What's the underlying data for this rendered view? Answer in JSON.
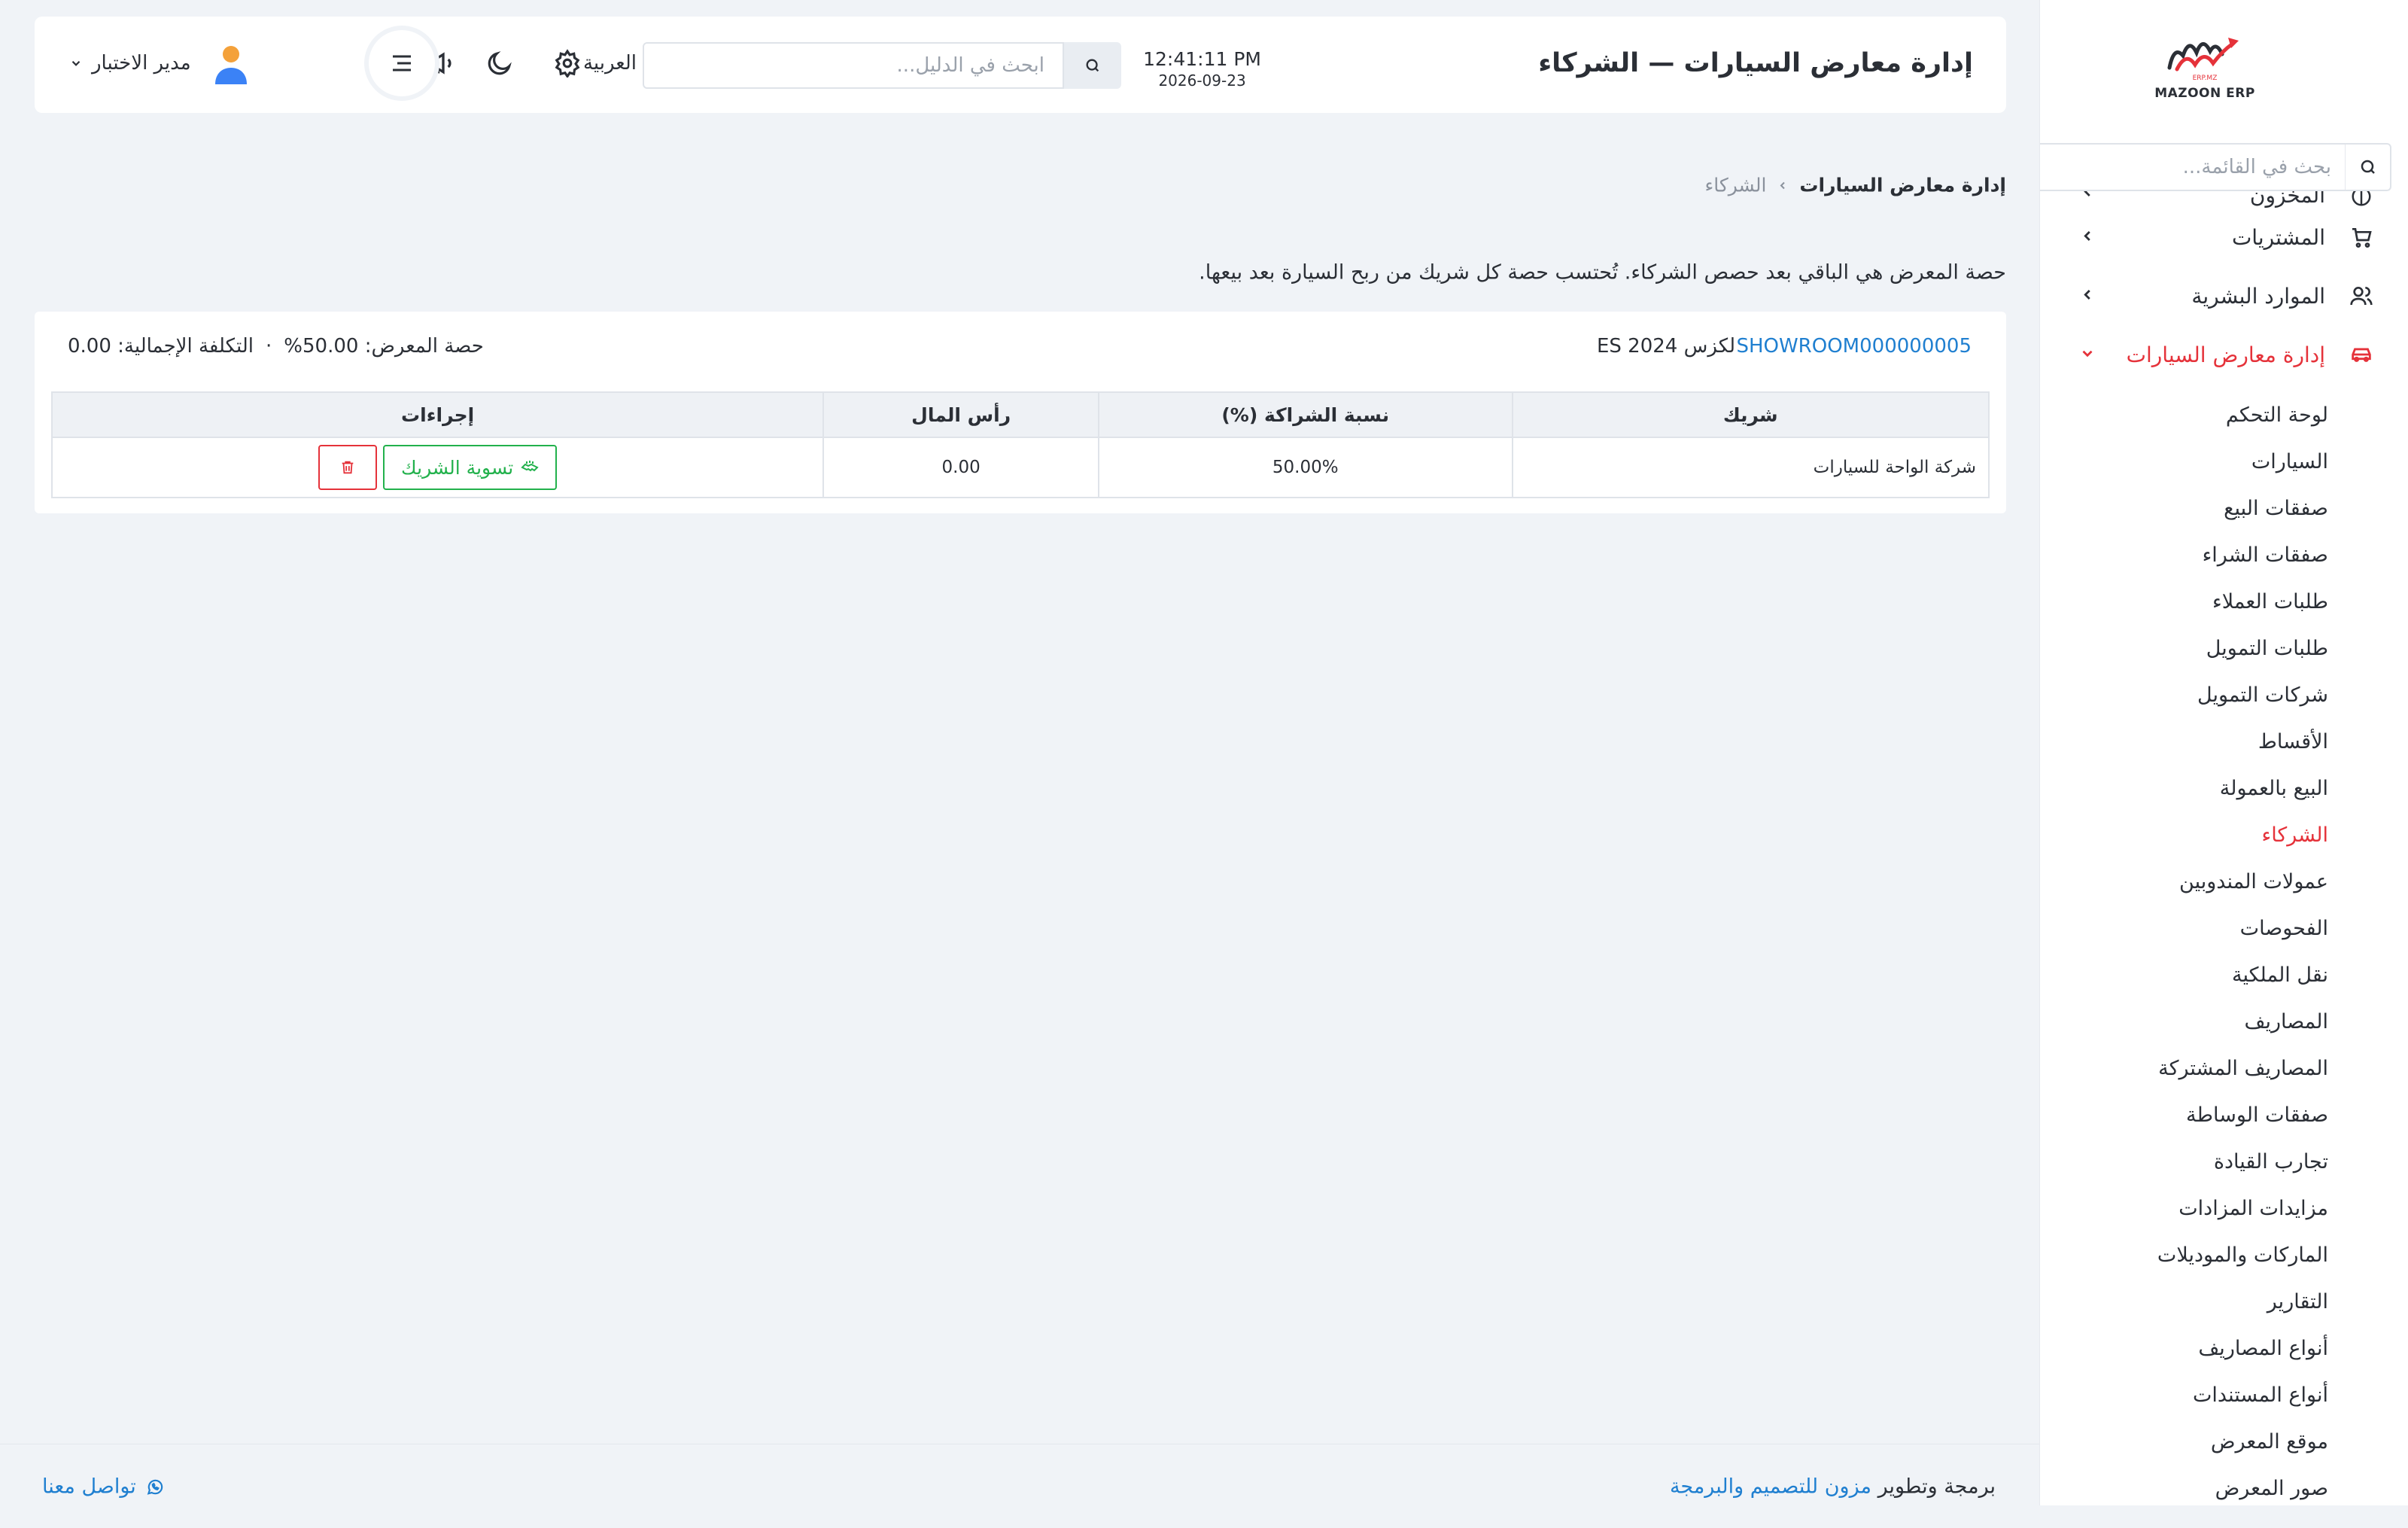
{
  "brand": {
    "name": "MAZOON ERP",
    "logo_text": "ERP.MZ"
  },
  "colors": {
    "accent": "#e5323a",
    "link": "#1f7fd0",
    "success": "#22b14c"
  },
  "sidebar": {
    "search_placeholder": "بحث في القائمة...",
    "clipped_item": {
      "label": "المخزون",
      "icon": "box-icon"
    },
    "items": [
      {
        "label": "المشتريات",
        "icon": "cart-icon"
      },
      {
        "label": "الموارد البشرية",
        "icon": "users-icon"
      },
      {
        "label": "إدارة معارض السيارات",
        "icon": "car-icon",
        "expanded": true
      }
    ],
    "submenu": [
      "لوحة التحكم",
      "السيارات",
      "صفقات البيع",
      "صفقات الشراء",
      "طلبات العملاء",
      "طلبات التمويل",
      "شركات التمويل",
      "الأقساط",
      "البيع بالعمولة",
      "الشركاء",
      "عمولات المندوبين",
      "الفحوصات",
      "نقل الملكية",
      "المصاريف",
      "المصاريف المشتركة",
      "صفقات الوساطة",
      "تجارب القيادة",
      "مزايدات المزادات",
      "الماركات والموديلات",
      "التقارير",
      "أنواع المصاريف",
      "أنواع المستندات",
      "موقع المعرض",
      "صور المعرض"
    ],
    "active_submenu": "الشركاء"
  },
  "header": {
    "title": "إدارة معارض السيارات — الشركاء",
    "time": "12:41:11 PM",
    "date": "2026-09-23",
    "search_placeholder": "ابحث في الدليل...",
    "language": "العربية",
    "user_name": "مدير الاختبار"
  },
  "breadcrumb": {
    "home": "إدارة معارض السيارات",
    "current": "الشركاء"
  },
  "note": "حصة المعرض هي الباقي بعد حصص الشركاء. تُحتسب حصة كل شريك من ربح السيارة بعد بيعها.",
  "card": {
    "car_code": "SHOWROOM000000005",
    "car_name": "لكزس ES 2024",
    "showroom_share": "حصة المعرض: 50.00%",
    "separator": "·",
    "total_cost": "التكلفة الإجمالية: 0.00"
  },
  "table": {
    "headers": {
      "partner": "شريك",
      "share": "نسبة الشراكة (%)",
      "capital": "رأس المال",
      "actions": "إجراءات"
    },
    "rows": [
      {
        "partner": "شركة الواحة للسيارات",
        "share": "50.00%",
        "capital": "0.00",
        "settle_label": "تسوية الشريك"
      }
    ]
  },
  "footer": {
    "credit_prefix": "برمجة وتطوير",
    "credit_link": "مزون للتصميم والبرمجة",
    "contact": "تواصل معنا"
  }
}
